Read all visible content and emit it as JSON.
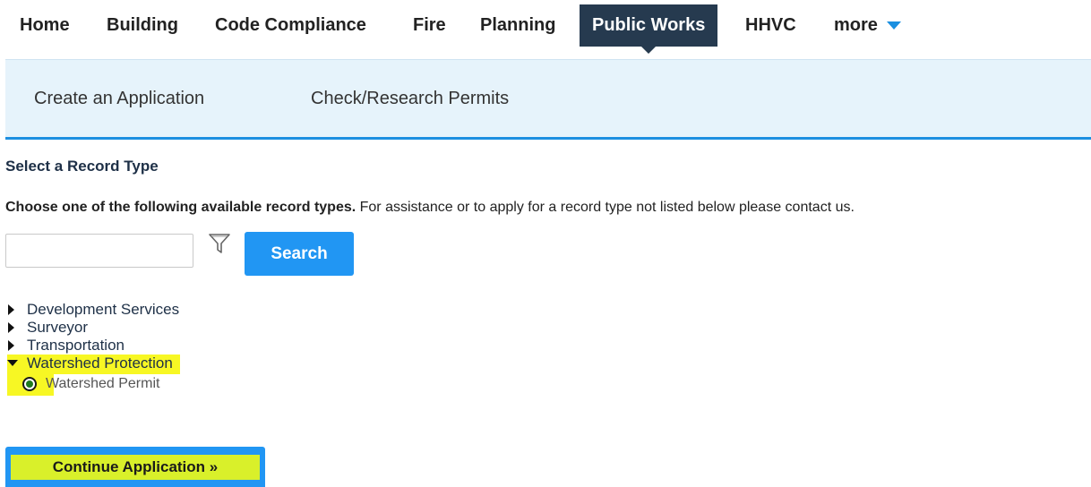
{
  "topnav": {
    "items": [
      {
        "label": "Home"
      },
      {
        "label": "Building"
      },
      {
        "label": "Code Compliance"
      },
      {
        "label": "Fire"
      },
      {
        "label": "Planning"
      },
      {
        "label": "Public Works",
        "active": true
      },
      {
        "label": "HHVC"
      },
      {
        "label": "more"
      }
    ]
  },
  "subnav": {
    "items": [
      {
        "label": "Create an Application"
      },
      {
        "label": "Check/Research Permits"
      }
    ]
  },
  "main": {
    "title": "Select a Record Type",
    "instructions_bold": "Choose one of the following available record types.",
    "instructions_rest": " For assistance or to apply for a record type not listed below please contact us.",
    "search": {
      "value": "",
      "placeholder": "",
      "button_label": "Search"
    },
    "tree": [
      {
        "label": "Development Services",
        "expanded": false
      },
      {
        "label": "Surveyor",
        "expanded": false
      },
      {
        "label": "Transportation",
        "expanded": false
      },
      {
        "label": "Watershed Protection",
        "expanded": true,
        "highlighted": true
      }
    ],
    "selected_record": {
      "label": "Watershed Permit",
      "checked": true
    },
    "continue_label": "Continue Application »"
  },
  "colors": {
    "active_tab": "#263a4f",
    "accent": "#2196f3",
    "subnav_bg": "#e6f3fb",
    "highlight": "#f7f724"
  }
}
